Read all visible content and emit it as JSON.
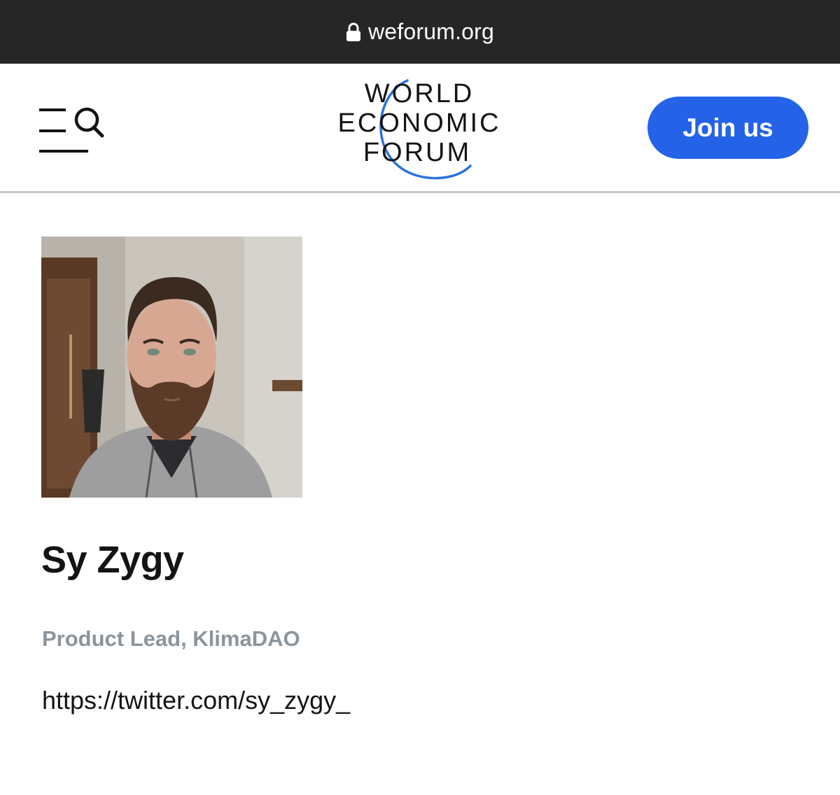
{
  "browser": {
    "url": "weforum.org",
    "lock_icon": "lock-icon"
  },
  "header": {
    "menu_icon": "menu-icon",
    "search_icon": "search-icon",
    "logo": {
      "line1": "WORLD",
      "line2": "ECONOMIC",
      "line3": "FORUM"
    },
    "join_label": "Join us",
    "accent_color": "#2462e8"
  },
  "profile": {
    "name": "Sy Zygy",
    "role": "Product Lead, KlimaDAO",
    "link": "https://twitter.com/sy_zygy_"
  }
}
